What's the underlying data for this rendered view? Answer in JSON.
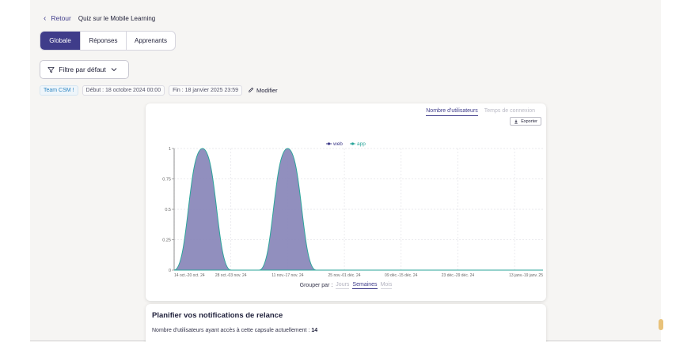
{
  "header": {
    "back_label": "Retour",
    "title": "Quiz sur le Mobile Learning"
  },
  "tabs": [
    {
      "label": "Globale",
      "active": true
    },
    {
      "label": "Réponses",
      "active": false
    },
    {
      "label": "Apprenants",
      "active": false
    }
  ],
  "filter": {
    "label": "Filtre par défaut"
  },
  "chips": {
    "team": "Team CSM !",
    "start": "Début : 18 octobre 2024 00:00",
    "end": "Fin : 18 janvier 2025 23:59",
    "modify": "Modifier"
  },
  "card": {
    "metric_tabs": [
      {
        "label": "Nombre d'utilisateurs",
        "active": true
      },
      {
        "label": "Temps de connexion",
        "active": false
      }
    ],
    "export_label": "Exporter",
    "group_by_label": "Grouper par :",
    "group_options": [
      {
        "label": "Jours",
        "active": false
      },
      {
        "label": "Semaines",
        "active": true
      },
      {
        "label": "Mois",
        "active": false
      }
    ]
  },
  "colors": {
    "accent": "#3f3c8a",
    "web": "#3f3c8a",
    "app": "#2aa59a",
    "area_fill": "#8b89ba"
  },
  "chart_data": {
    "type": "area",
    "categories": [
      "14 oct.-20 oct. 24",
      "28 oct.-03 nov. 24",
      "11 nov.-17 nov. 24",
      "25 nov.-01 déc. 24",
      "09 déc.-15 déc. 24",
      "23 déc.-29 déc. 24",
      "13 janv.-19 janv. 25"
    ],
    "x": [
      0,
      1,
      2,
      3,
      4,
      5,
      6,
      7,
      8,
      9,
      10,
      11,
      12,
      13
    ],
    "series": [
      {
        "name": "web",
        "values": [
          0,
          1,
          0,
          0,
          1,
          0,
          0,
          0,
          0,
          0,
          0,
          0,
          0,
          0
        ]
      },
      {
        "name": "app",
        "values": [
          0,
          0,
          0,
          0,
          0,
          0,
          0,
          0,
          0,
          0,
          0,
          0,
          0,
          0
        ]
      }
    ],
    "yticks": [
      "0",
      "0.25",
      "0.5",
      "0.75",
      "1"
    ],
    "ylim": [
      0,
      1
    ],
    "legend": "top-center",
    "grid": true
  },
  "relance": {
    "title": "Planifier vos notifications de relance",
    "text": "Nombre d'utilisateurs ayant accès à cette capsule actuellement :",
    "count": "14"
  }
}
